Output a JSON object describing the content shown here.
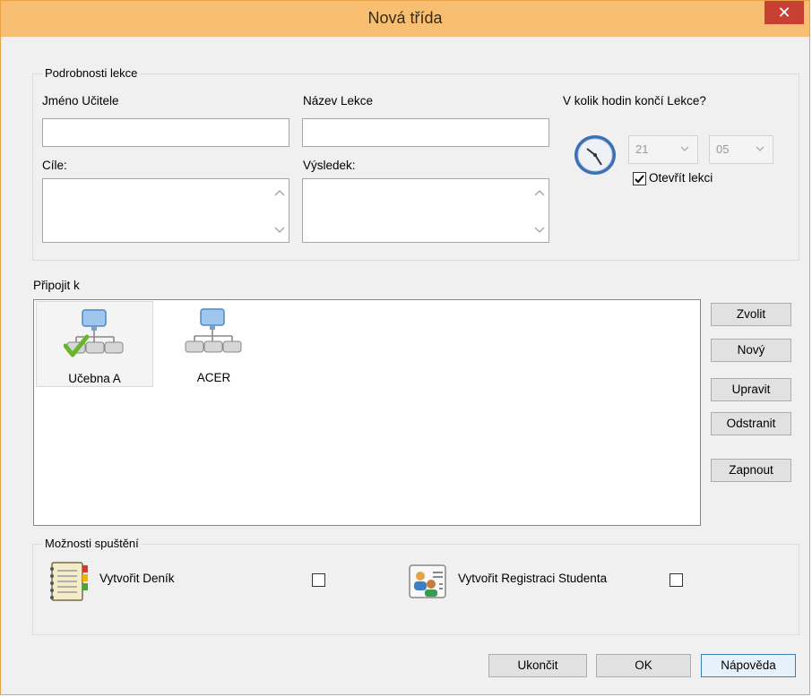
{
  "window": {
    "title": "Nová třída",
    "close_label": "✕"
  },
  "details": {
    "group_label": "Podrobnosti lekce",
    "teacher_label": "Jméno Učitele",
    "teacher_value": "",
    "lesson_label": "Název Lekce",
    "lesson_value": "",
    "goals_label": "Cíle:",
    "goals_value": "",
    "result_label": "Výsledek:",
    "result_value": "",
    "end_time_label": "V kolik hodin končí Lekce?",
    "hour": "21",
    "minute": "05",
    "open_lesson_label": "Otevřít lekci",
    "open_lesson_checked": true
  },
  "connect": {
    "label": "Připojit k",
    "items": [
      {
        "label": "Učebna A",
        "icon": "network-check-icon",
        "selected": true
      },
      {
        "label": "ACER",
        "icon": "network-icon",
        "selected": false
      }
    ],
    "buttons": {
      "select": "Zvolit",
      "new": "Nový",
      "edit": "Upravit",
      "remove": "Odstranit",
      "enable": "Zapnout"
    }
  },
  "startup": {
    "group_label": "Možnosti spuštění",
    "diary_label": "Vytvořit Deník",
    "diary_checked": false,
    "registration_label": "Vytvořit Registraci Studenta",
    "registration_checked": false
  },
  "footer": {
    "exit": "Ukončit",
    "ok": "OK",
    "help": "Nápověda"
  },
  "colors": {
    "titlebar": "#f8bf72",
    "close": "#c84032",
    "window_border": "#e8a24a"
  }
}
